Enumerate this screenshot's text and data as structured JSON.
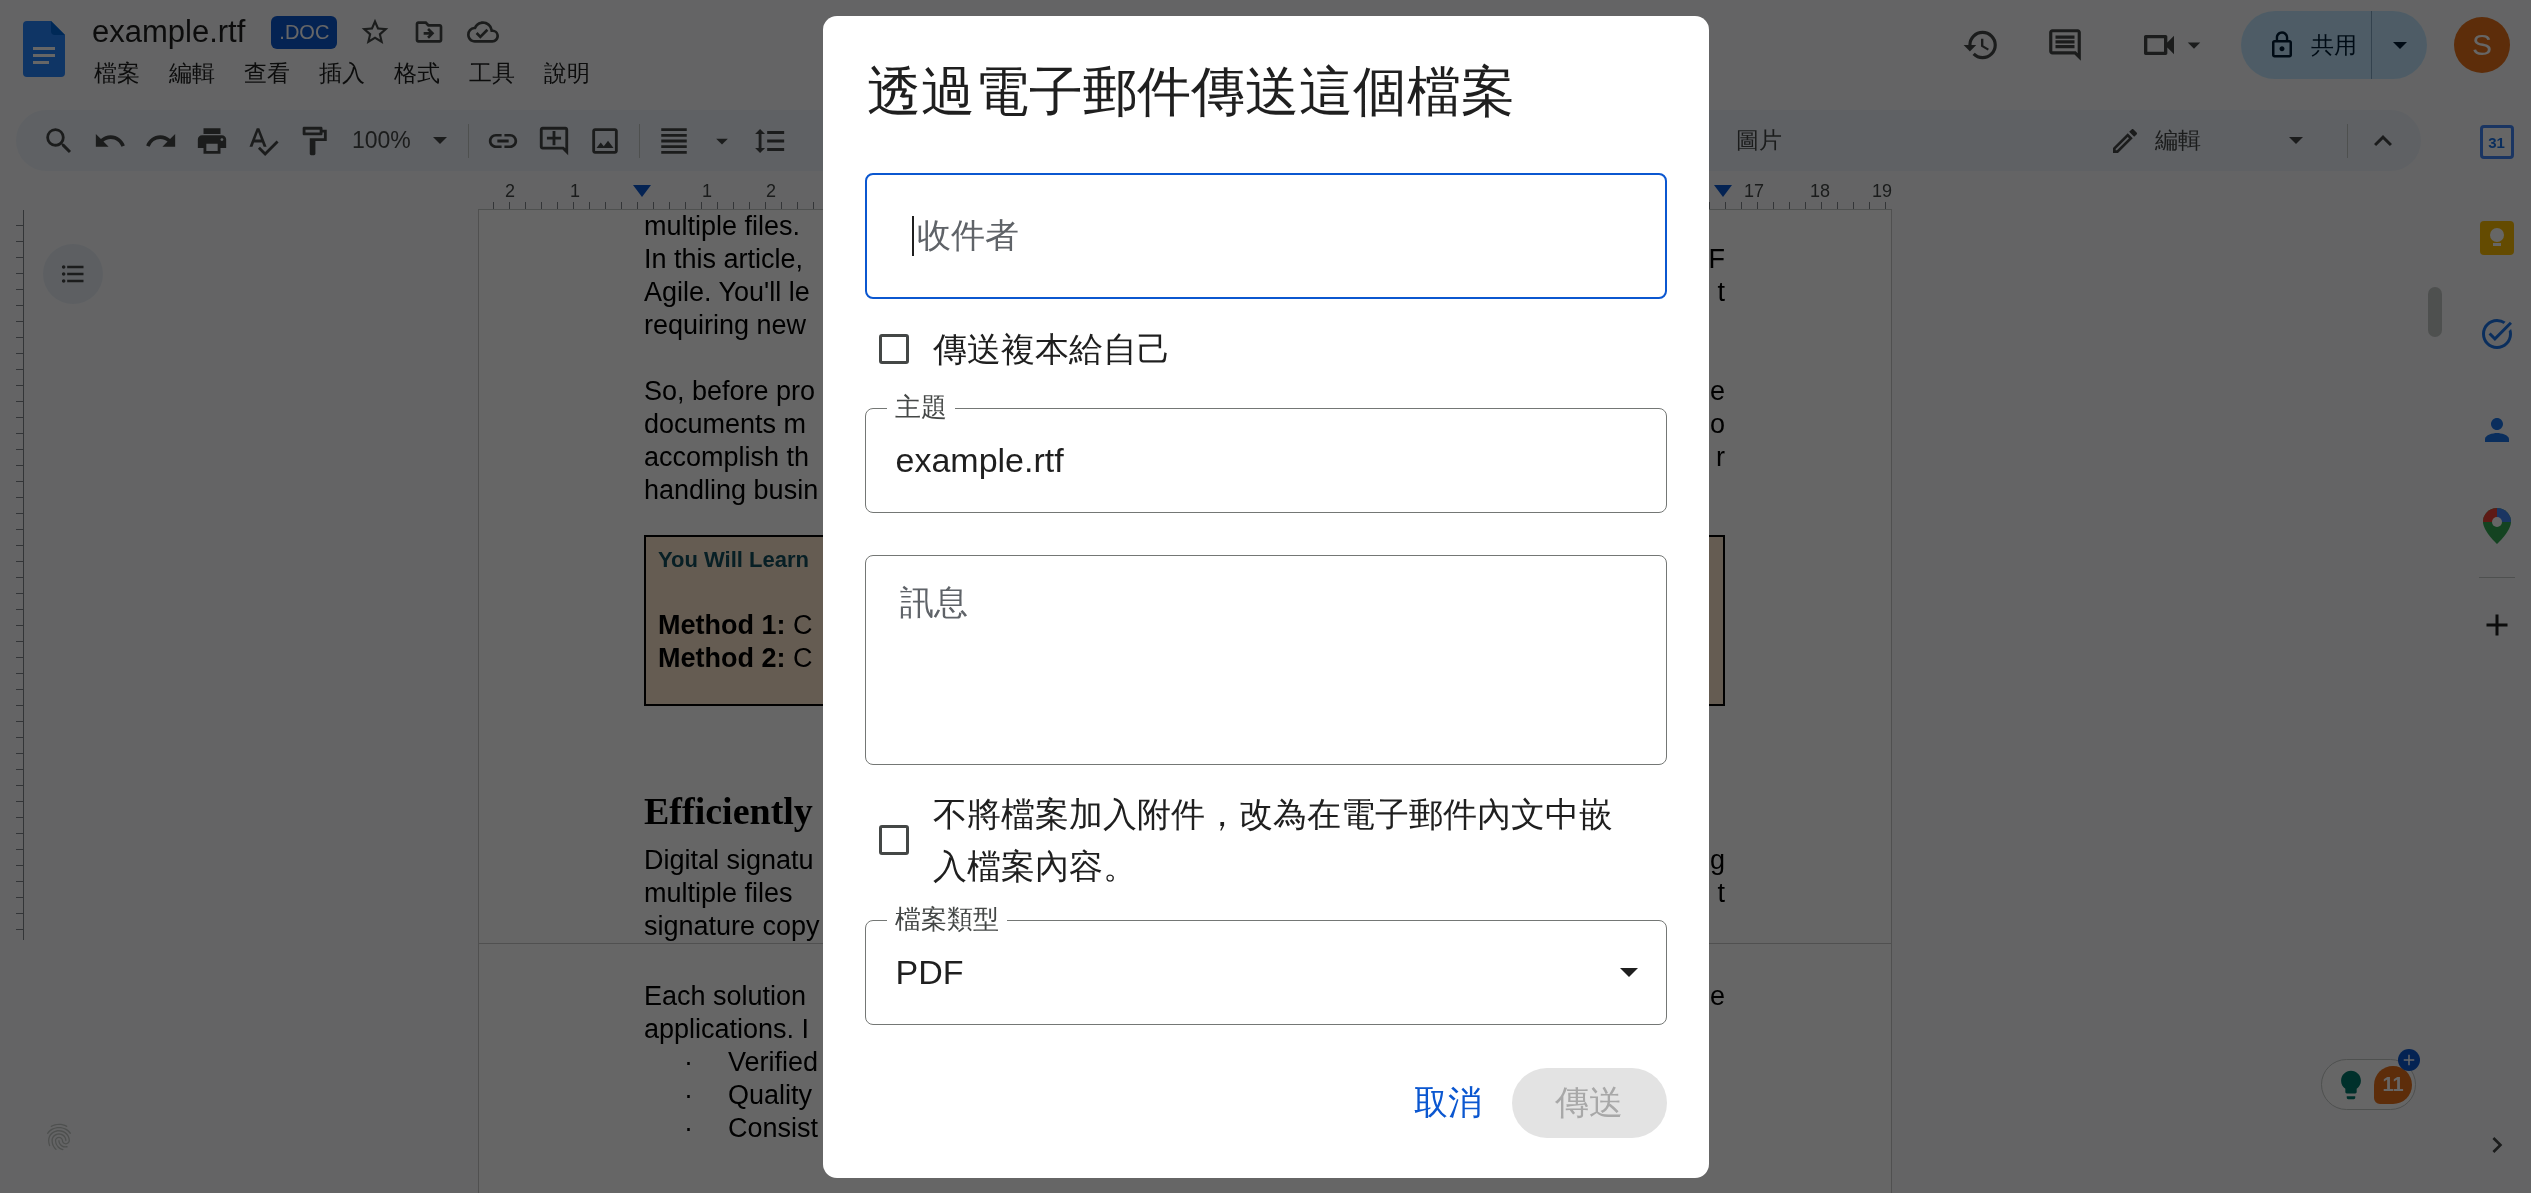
{
  "header": {
    "title": "example.rtf",
    "badge": ".DOC",
    "menu": [
      "檔案",
      "編輯",
      "查看",
      "插入",
      "格式",
      "工具",
      "說明"
    ],
    "share_button": "共用",
    "avatar": "S"
  },
  "toolbar": {
    "zoom": "100%",
    "partial_label": "圖片",
    "mode": "編輯"
  },
  "ruler": {
    "left_labels": [
      "2",
      "1",
      "1",
      "2"
    ],
    "right_labels": [
      "17",
      "18",
      "19"
    ]
  },
  "document": {
    "blocks": [
      {
        "kind": "line",
        "left": "multiple files."
      },
      {
        "kind": "line",
        "left": "In this article,",
        "right": "F"
      },
      {
        "kind": "line",
        "left": "Agile. You'll le",
        "right": "t"
      },
      {
        "kind": "line",
        "left": "requiring new"
      },
      {
        "kind": "blank"
      },
      {
        "kind": "line",
        "left": "So, before pro",
        "right": "e"
      },
      {
        "kind": "line",
        "left": "documents m",
        "right": "o"
      },
      {
        "kind": "line",
        "left": "accomplish th",
        "right": "r"
      },
      {
        "kind": "line",
        "left": "handling busin"
      },
      {
        "kind": "callout",
        "title": "You Will Learn",
        "lines": [
          "**Method 1:** C",
          "**Method 2:** C"
        ]
      },
      {
        "kind": "heading",
        "text": "Efficiently"
      },
      {
        "kind": "line",
        "left": "Digital signatu",
        "right": "g"
      },
      {
        "kind": "line",
        "left": "multiple files",
        "right": "t"
      },
      {
        "kind": "line",
        "left": "signature copy"
      },
      {
        "kind": "page_break"
      },
      {
        "kind": "line",
        "left": "Each solution",
        "right": "e"
      },
      {
        "kind": "line",
        "left": "applications. I"
      },
      {
        "kind": "bullet",
        "marker": "·",
        "text": "Verified"
      },
      {
        "kind": "bullet",
        "marker": "·",
        "text": "Quality"
      },
      {
        "kind": "bullet",
        "marker": "·",
        "text": "Consist"
      }
    ]
  },
  "side_panel": {
    "calendar_day": "31",
    "badge_count": "11"
  },
  "dialog": {
    "title": "透過電子郵件傳送這個檔案",
    "recipients": {
      "placeholder": "收件者",
      "focused": true
    },
    "send_copy": {
      "label": "傳送複本給自己",
      "checked": false
    },
    "subject": {
      "label": "主題",
      "value": "example.rtf"
    },
    "message": {
      "placeholder": "訊息"
    },
    "inline": {
      "label": "不將檔案加入附件，改為在電子郵件內文中嵌入檔案內容。",
      "checked": false
    },
    "file_type": {
      "label": "檔案類型",
      "value": "PDF"
    },
    "buttons": [
      {
        "label": "取消",
        "kind": "text",
        "disabled": false
      },
      {
        "label": "傳送",
        "kind": "filled",
        "disabled": true
      }
    ]
  }
}
